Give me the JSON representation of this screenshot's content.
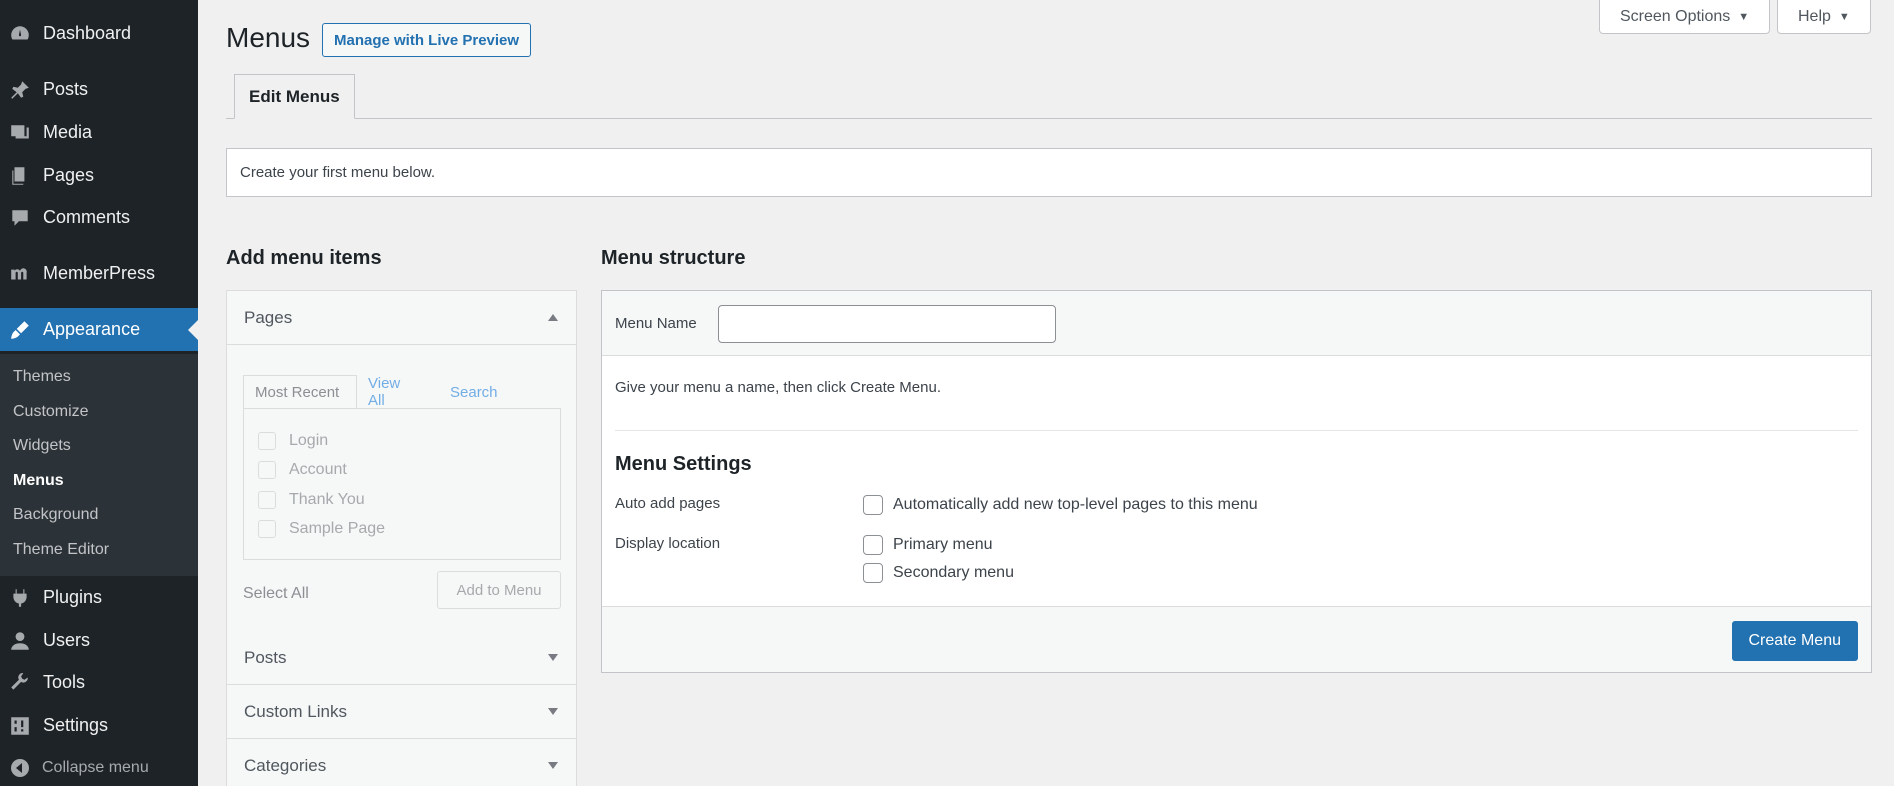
{
  "sidebar": {
    "items": [
      {
        "label": "Dashboard",
        "icon": "dashboard-icon"
      },
      {
        "label": "Posts",
        "icon": "pin-icon"
      },
      {
        "label": "Media",
        "icon": "media-icon"
      },
      {
        "label": "Pages",
        "icon": "pages-icon"
      },
      {
        "label": "Comments",
        "icon": "comment-icon"
      },
      {
        "label": "MemberPress",
        "icon": "memberpress-icon"
      },
      {
        "label": "Appearance",
        "icon": "brush-icon"
      },
      {
        "label": "Plugins",
        "icon": "plugin-icon"
      },
      {
        "label": "Users",
        "icon": "user-icon"
      },
      {
        "label": "Tools",
        "icon": "wrench-icon"
      },
      {
        "label": "Settings",
        "icon": "settings-icon"
      }
    ],
    "submenu": [
      "Themes",
      "Customize",
      "Widgets",
      "Menus",
      "Background",
      "Theme Editor"
    ],
    "collapse_label": "Collapse menu",
    "active_color": "#2271b1"
  },
  "header": {
    "title": "Menus",
    "live_preview_label": "Manage with Live Preview",
    "screen_options_label": "Screen Options",
    "help_label": "Help"
  },
  "tabs": {
    "edit_menus": "Edit Menus"
  },
  "notice": "Create your first menu below.",
  "add_items": {
    "title": "Add menu items",
    "pages_section": "Pages",
    "page_tabs": [
      "Most Recent",
      "View All",
      "Search"
    ],
    "pages": [
      "Login",
      "Account",
      "Thank You",
      "Sample Page"
    ],
    "select_all": "Select All",
    "add_button": "Add to Menu",
    "sections": [
      "Posts",
      "Custom Links",
      "Categories"
    ]
  },
  "structure": {
    "title": "Menu structure",
    "menu_name_label": "Menu Name",
    "menu_name_value": "",
    "hint": "Give your menu a name, then click Create Menu.",
    "settings_title": "Menu Settings",
    "auto_add_label": "Auto add pages",
    "auto_add_option": "Automatically add new top-level pages to this menu",
    "display_location_label": "Display location",
    "locations": [
      "Primary menu",
      "Secondary menu"
    ],
    "create_button": "Create Menu"
  }
}
